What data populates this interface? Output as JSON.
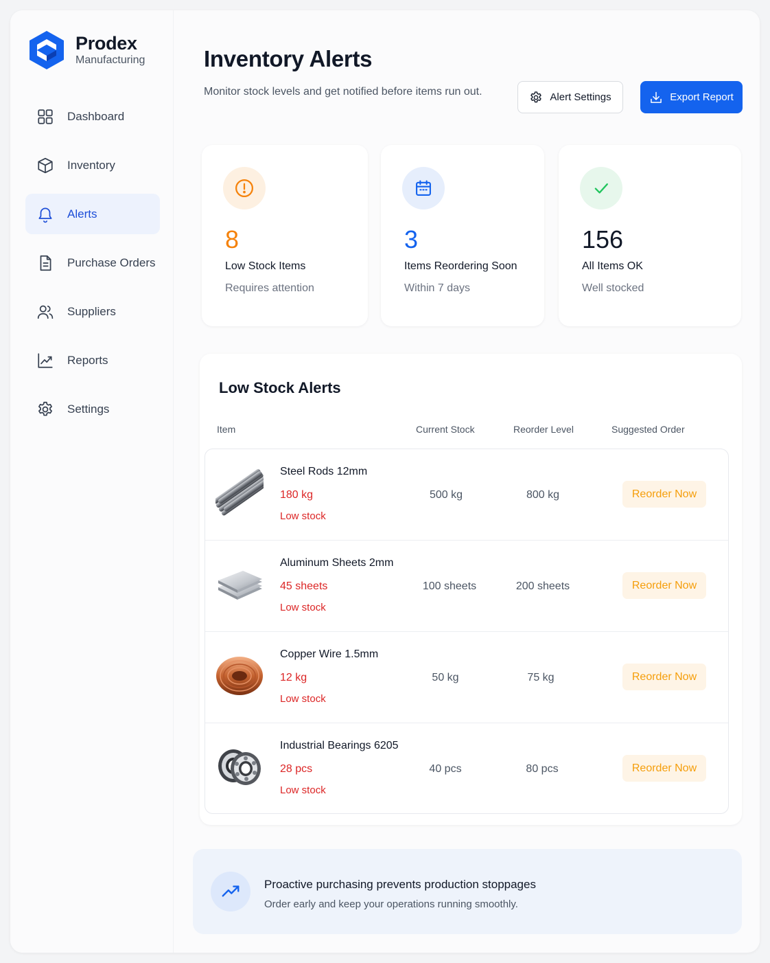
{
  "brand": {
    "name": "Prodex",
    "subtitle": "Manufacturing"
  },
  "sidebar": {
    "items": [
      {
        "label": "Dashboard",
        "icon": "dashboard-grid-icon"
      },
      {
        "label": "Inventory",
        "icon": "box-icon"
      },
      {
        "label": "Alerts",
        "icon": "bell-icon",
        "active": true
      },
      {
        "label": "Purchase Orders",
        "icon": "document-icon"
      },
      {
        "label": "Suppliers",
        "icon": "users-icon"
      },
      {
        "label": "Reports",
        "icon": "chart-line-icon"
      },
      {
        "label": "Settings",
        "icon": "gear-icon"
      }
    ]
  },
  "header": {
    "title": "Inventory Alerts",
    "subtitle": "Monitor stock levels and get notified before items run out.",
    "alert_settings_label": "Alert Settings",
    "export_label": "Export Report"
  },
  "stats": [
    {
      "value": "8",
      "label": "Low Stock Items",
      "note": "Requires attention",
      "color": "#f5820b",
      "icon": "warning-circle-icon"
    },
    {
      "value": "3",
      "label": "Items Reordering Soon",
      "note": "Within 7 days",
      "color": "#1463ee",
      "icon": "calendar-icon"
    },
    {
      "value": "156",
      "label": "All Items OK",
      "note": "Well stocked",
      "color": "#111827",
      "icon": "check-icon"
    }
  ],
  "table": {
    "title": "Low Stock Alerts",
    "columns": {
      "item": "Item",
      "current": "Current Stock",
      "reorder": "Reorder Level",
      "suggested": "Suggested Order"
    },
    "rows": [
      {
        "name": "Steel Rods 12mm",
        "qty": "180 kg",
        "status": "Low stock",
        "current": "500 kg",
        "reorder_level": "800 kg",
        "action": "Reorder Now",
        "image": "steel-rods"
      },
      {
        "name": "Aluminum Sheets 2mm",
        "qty": "45 sheets",
        "status": "Low stock",
        "current": "100 sheets",
        "reorder_level": "200 sheets",
        "action": "Reorder Now",
        "image": "aluminum-sheets"
      },
      {
        "name": "Copper Wire 1.5mm",
        "qty": "12 kg",
        "status": "Low stock",
        "current": "50 kg",
        "reorder_level": "75 kg",
        "action": "Reorder Now",
        "image": "copper-wire"
      },
      {
        "name": "Industrial Bearings 6205",
        "qty": "28 pcs",
        "status": "Low stock",
        "current": "40 pcs",
        "reorder_level": "80 pcs",
        "action": "Reorder Now",
        "image": "bearings"
      }
    ]
  },
  "banner": {
    "title": "Proactive purchasing prevents production stoppages",
    "subtitle": "Order early and keep your operations running smoothly.",
    "icon": "trending-up-icon"
  },
  "colors": {
    "accent": "#1463ee",
    "danger": "#dc2626",
    "warning": "#f59e0b",
    "success": "#22c55e"
  }
}
